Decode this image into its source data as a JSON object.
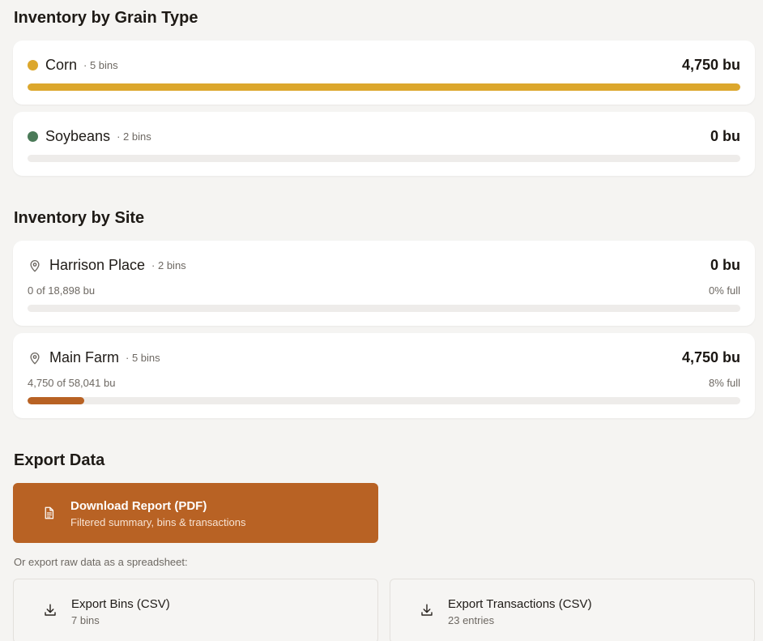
{
  "grain_section": {
    "title": "Inventory by Grain Type",
    "items": [
      {
        "name": "Corn",
        "meta": "· 5 bins",
        "amount": "4,750 bu",
        "color": "#dca72c",
        "fill_fraction": 1.0
      },
      {
        "name": "Soybeans",
        "meta": "· 2 bins",
        "amount": "0 bu",
        "color": "#4a7a58",
        "fill_fraction": 0.0
      }
    ]
  },
  "site_section": {
    "title": "Inventory by Site",
    "items": [
      {
        "name": "Harrison Place",
        "meta": "· 2 bins",
        "amount": "0 bu",
        "capacity": "0 of 18,898 bu",
        "percent": "0% full",
        "fill_fraction": 0.0,
        "color": "#b86224",
        "icon": "map-pin-icon"
      },
      {
        "name": "Main Farm",
        "meta": "· 5 bins",
        "amount": "4,750 bu",
        "capacity": "4,750 of 58,041 bu",
        "percent": "8% full",
        "fill_fraction": 0.08,
        "color": "#b86224",
        "icon": "map-pin-icon"
      }
    ]
  },
  "export_section": {
    "title": "Export Data",
    "pdf_button": {
      "label": "Download Report (PDF)",
      "sub": "Filtered summary, bins & transactions",
      "icon": "document-icon",
      "color": "#b86224"
    },
    "hint": "Or export raw data as a spreadsheet:",
    "bins_button": {
      "label": "Export Bins (CSV)",
      "sub": "7 bins",
      "icon": "download-icon"
    },
    "transactions_button": {
      "label": "Export Transactions (CSV)",
      "sub": "23 entries",
      "icon": "download-icon"
    }
  }
}
